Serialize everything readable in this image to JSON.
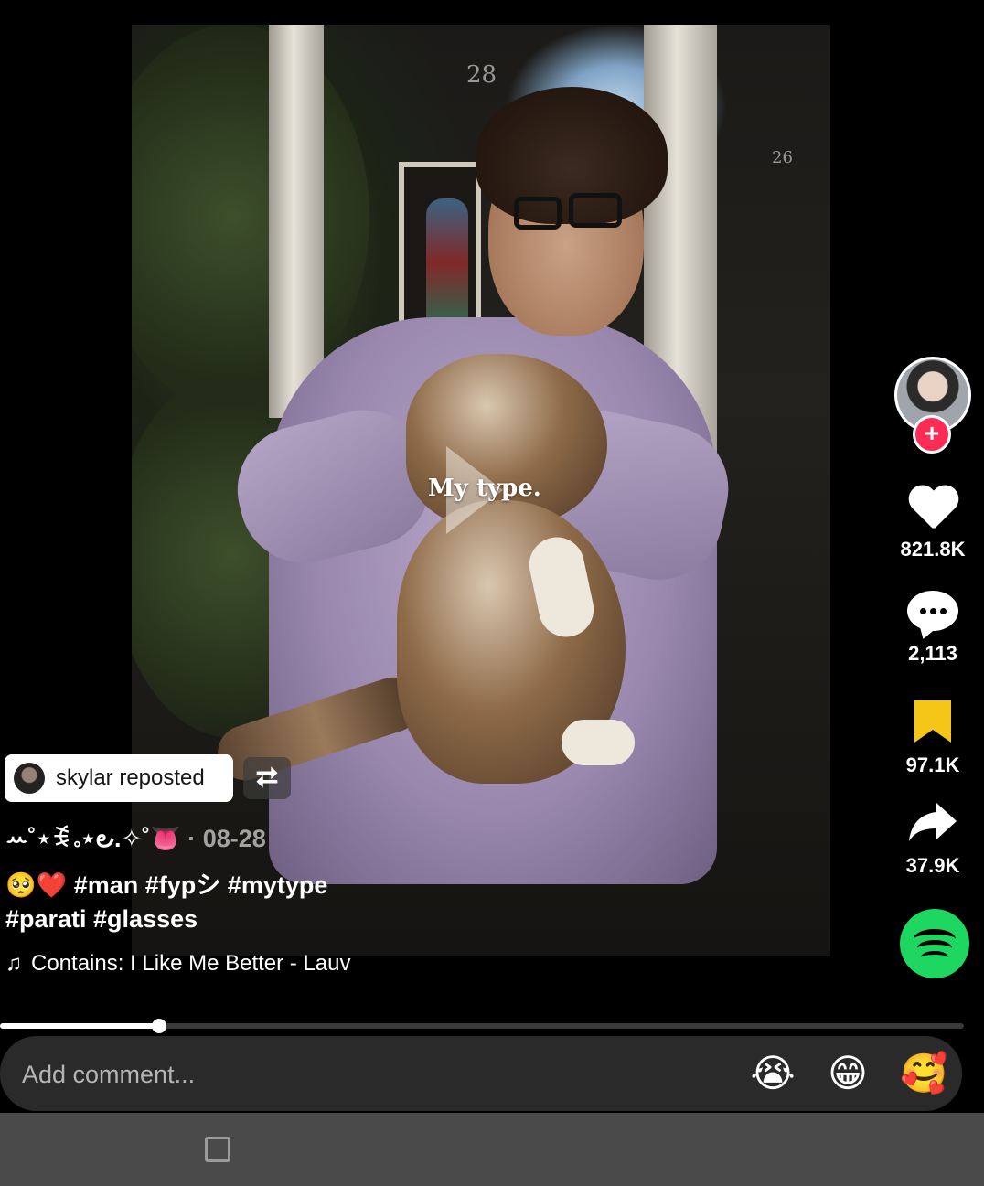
{
  "video": {
    "overlay_text": "My type.",
    "house_number_left": "28",
    "house_number_right": "26"
  },
  "rail": {
    "likes": "821.8K",
    "comments": "2,113",
    "saves": "97.1K",
    "shares": "37.9K",
    "follow_symbol": "+",
    "icons": [
      "profile-avatar",
      "heart-icon",
      "comment-icon",
      "bookmark-icon",
      "share-icon",
      "spotify-icon"
    ],
    "colors": {
      "follow": "#fe2c55",
      "bookmark": "#f5c518",
      "spotify": "#1ed760"
    }
  },
  "repost": {
    "text": "skylar reposted",
    "repost_symbol": "⮂"
  },
  "post": {
    "author": "ꕀ˚⋆ꉂ｡⋆౿.✧˚👅",
    "date": "· 08-28",
    "emojis": "🥺❤️",
    "hashtags_line1": " #man #fypシ #mytype",
    "hashtags_line2": "#parati #glasses",
    "music_note": "♫",
    "music": "Contains: I Like Me Better - Lauv"
  },
  "progress": {
    "fraction": 0.165
  },
  "comment": {
    "placeholder": "Add comment...",
    "emoji_1": "😭",
    "emoji_2": "😁",
    "emoji_3": "🥰"
  }
}
